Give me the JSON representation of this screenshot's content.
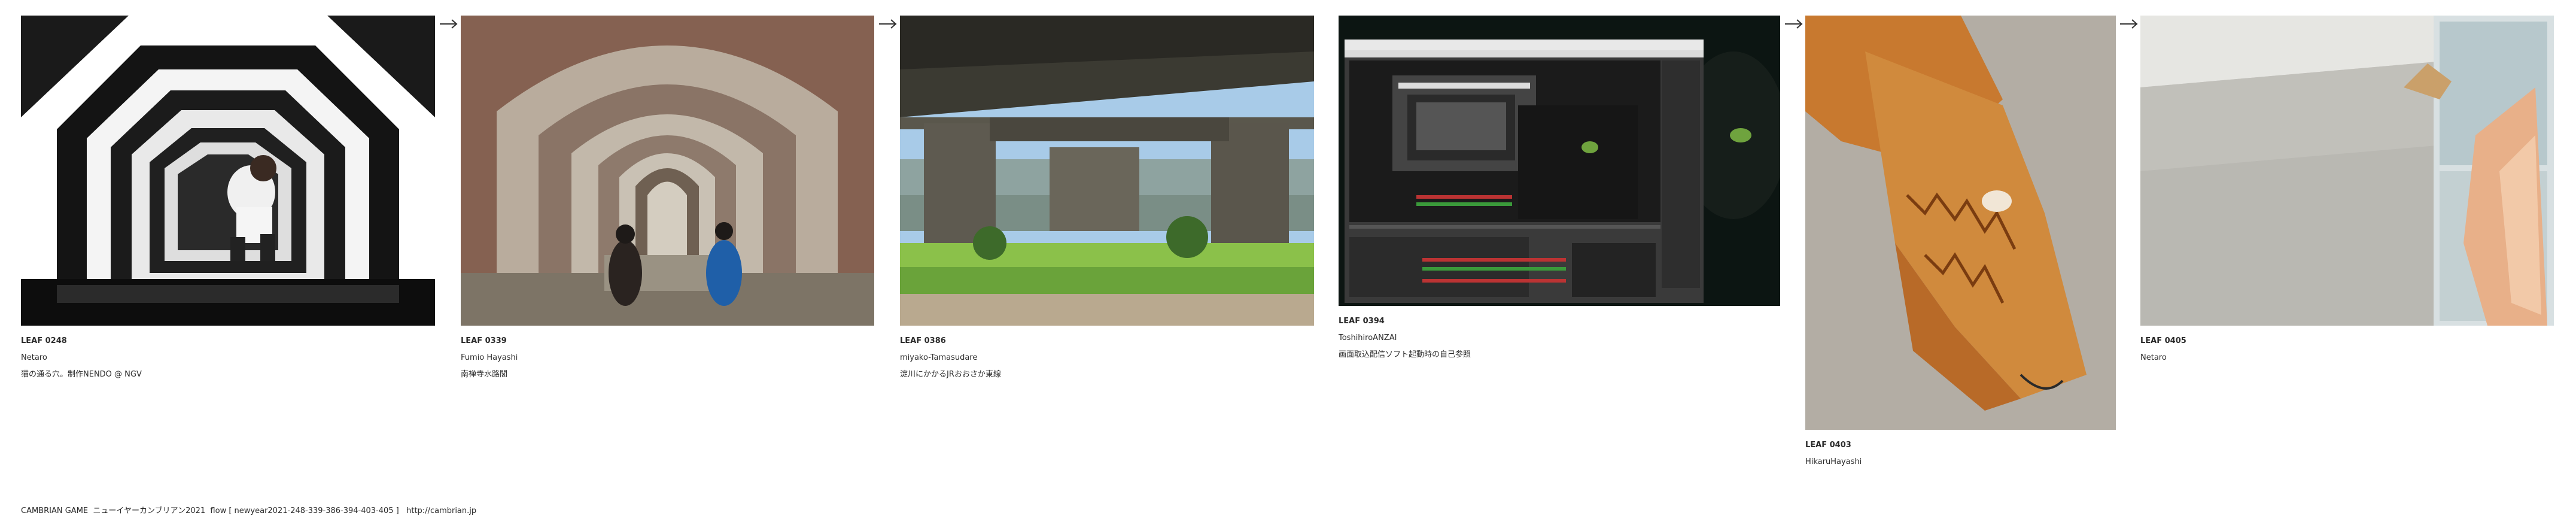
{
  "leaves": [
    {
      "id": "LEAF 0248",
      "author": "Netaro",
      "title": "猫の通る穴。制作NENDO @ NGV",
      "image": "photo-leaf-0248"
    },
    {
      "id": "LEAF 0339",
      "author": "Fumio Hayashi",
      "title": "南禅寺水路閣",
      "image": "photo-leaf-0339"
    },
    {
      "id": "LEAF 0386",
      "author": "miyako-Tamasudare",
      "title": "淀川にかかるJRおおさか東線",
      "image": "photo-leaf-0386"
    },
    {
      "id": "LEAF 0394",
      "author": "ToshihiroANZAI",
      "title": "画面取込配信ソフト起動時の自己参照",
      "image": "photo-leaf-0394"
    },
    {
      "id": "LEAF 0403",
      "author": "HikaruHayashi",
      "title": "",
      "image": "photo-leaf-0403"
    },
    {
      "id": "LEAF 0405",
      "author": "Netaro",
      "title": "",
      "image": "photo-leaf-0405"
    }
  ],
  "footer": {
    "text": "CAMBRIAN GAME  ニューイヤーカンブリアン2021  flow [ newyear2021-248-339-386-394-403-405 ]   ",
    "link": "http://cambrian.jp"
  },
  "icons": {
    "connector": "arrow-right-icon"
  }
}
